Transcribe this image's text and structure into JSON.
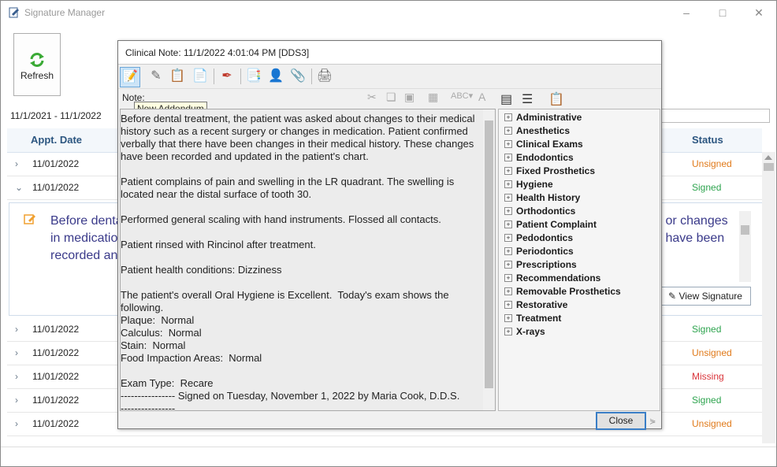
{
  "app": {
    "title": "Signature Manager",
    "refresh_label": "Refresh",
    "date_range": "11/1/2021 - 11/1/2022"
  },
  "grid": {
    "headers": {
      "appt_date": "Appt. Date",
      "status": "Status"
    },
    "rows": [
      {
        "date": "11/01/2022",
        "status": "Unsigned",
        "status_color": "#e07a1a"
      },
      {
        "date": "11/01/2022",
        "status": "Signed",
        "status_color": "#2ea44f"
      },
      {
        "date": "11/01/2022",
        "status": "Signed",
        "status_color": "#2ea44f"
      },
      {
        "date": "11/01/2022",
        "status": "Unsigned",
        "status_color": "#e07a1a"
      },
      {
        "date": "11/01/2022",
        "status": "Missing",
        "status_color": "#d9343a"
      },
      {
        "date": "11/01/2022",
        "status": "Signed",
        "status_color": "#2ea44f"
      },
      {
        "date": "11/01/2022",
        "status": "Unsigned",
        "status_color": "#e07a1a"
      }
    ],
    "detail": {
      "left_text_1": "Before denta",
      "left_text_2": "in medicatio",
      "left_text_3": "recorded an",
      "right_text_1": "y or changes",
      "right_text_2": "s have been",
      "view_signature": "View Signature"
    }
  },
  "dialog": {
    "title": "Clinical Note: 11/1/2022 4:01:04 PM [DDS3]",
    "note_label": "Note:",
    "tooltip": "New Addendum",
    "note_text": "Before dental treatment, the patient was asked about changes to their medical history such as a recent surgery or changes in medication. Patient confirmed verbally that there have been changes in their medical history. These changes have been recorded and updated in the patient's chart.\n\nPatient complains of pain and swelling in the LR quadrant. The swelling is located near the distal surface of tooth 30.\n\nPerformed general scaling with hand instruments. Flossed all contacts.\n\nPatient rinsed with Rincinol after treatment.\n\nPatient health conditions: Dizziness\n\nThe patient's overall Oral Hygiene is Excellent.  Today's exam shows the following.\nPlaque:  Normal\nCalculus:  Normal\nStain:  Normal\nFood Impaction Areas:  Normal\n\nExam Type:  Recare\n---------------- Signed on Tuesday, November 1, 2022 by Maria Cook, D.D.S.\n----------------",
    "tree": [
      "Administrative",
      "Anesthetics",
      "Clinical Exams",
      "Endodontics",
      "Fixed Prosthetics",
      "Hygiene",
      "Health History",
      "Orthodontics",
      "Patient Complaint",
      "Pedodontics",
      "Periodontics",
      "Prescriptions",
      "Recommendations",
      "Removable Prosthetics",
      "Restorative",
      "Treatment",
      "X-rays"
    ],
    "close_label": "Close"
  }
}
